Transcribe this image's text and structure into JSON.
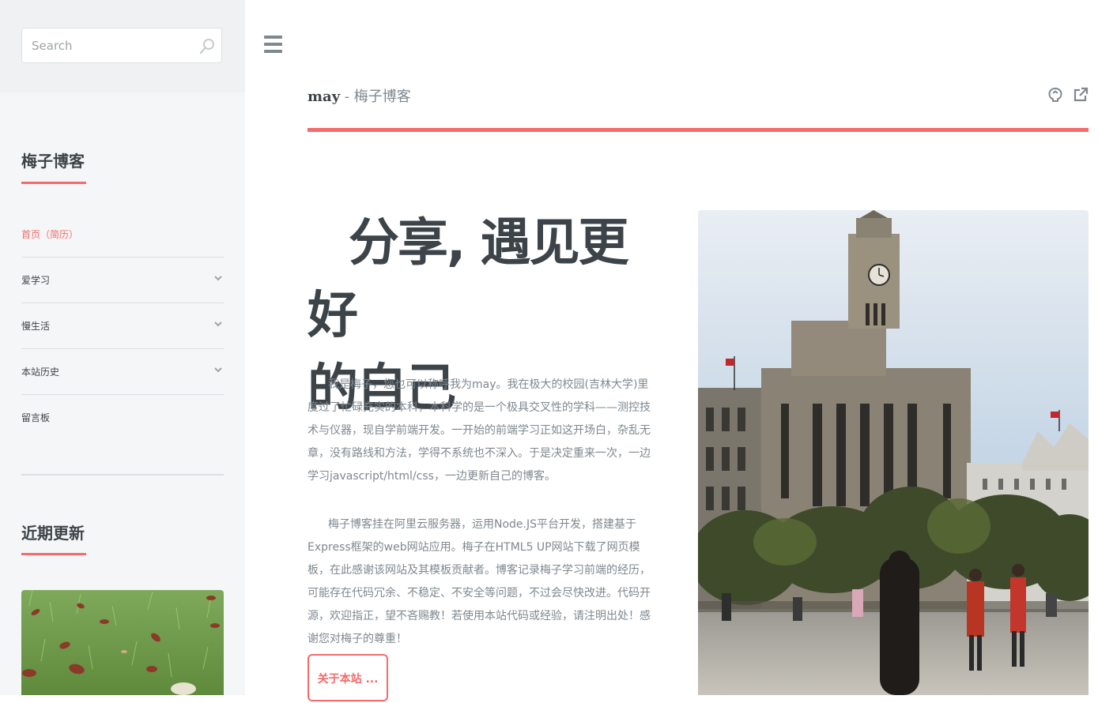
{
  "search": {
    "placeholder": "Search"
  },
  "sidebar": {
    "menu_heading": "梅子博客",
    "menu_items": [
      {
        "label": "首页（简历）",
        "active": true
      },
      {
        "label": "爱学习",
        "has_submenu": true
      },
      {
        "label": "慢生活",
        "has_submenu": true
      },
      {
        "label": "本站历史",
        "has_submenu": true
      },
      {
        "label": "留言板"
      }
    ],
    "recent_heading": "近期更新"
  },
  "header": {
    "logo_strong": "may",
    "logo_rest": " - 梅子博客",
    "icons": [
      "github-icon",
      "external-link-icon"
    ]
  },
  "banner": {
    "title_line1": "分享, 遇见更好",
    "title_line2": "的自己",
    "paragraph1": "我是梅子，您也可以称呼我为may。我在极大的校园(吉林大学)里度过了忙碌充实的本科，本科学的是一个极具交叉性的学科——测控技术与仪器，现自学前端开发。一开始的前端学习正如这开场白，杂乱无章，没有路线和方法，学得不系统也不深入。于是决定重来一次，一边学习javascript/html/css，一边更新自己的博客。",
    "paragraph2": "梅子博客挂在阿里云服务器，运用Node.JS平台开发，搭建基于Express框架的web网站应用。梅子在HTML5 UP网站下载了网页模板，在此感谢该网站及其模板贡献者。博客记录梅子学习前端的经历，可能存在代码冗余、不稳定、不安全等问题，不过会尽快改进。代码开源，欢迎指正，望不吝赐教！若使用本站代码或经验，请注明出处！感谢您对梅子的尊重！",
    "button_label": "关于本站 ..."
  },
  "colors": {
    "accent": "#f56a6a",
    "text": "#3d4449",
    "muted": "#7f888f",
    "sidebar_bg": "#f5f6f7"
  }
}
